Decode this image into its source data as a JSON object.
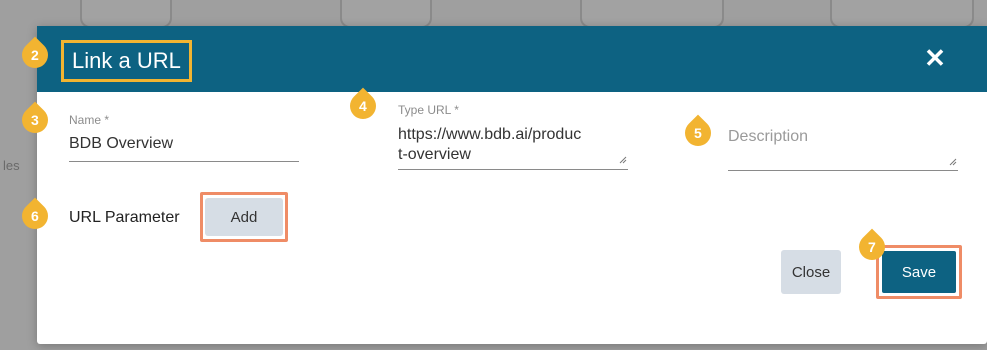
{
  "background": {
    "partial_text": "les"
  },
  "dialog": {
    "title": "Link a URL",
    "close_symbol": "✕",
    "fields": {
      "name": {
        "label": "Name *",
        "value": "BDB Overview"
      },
      "type_url": {
        "label": "Type URL *",
        "value_line1": "https://www.bdb.ai/produc",
        "value_line2": "t-overview"
      },
      "description": {
        "placeholder": "Description"
      }
    },
    "url_parameter": {
      "label": "URL Parameter",
      "add_label": "Add"
    },
    "footer": {
      "close_label": "Close",
      "save_label": "Save"
    }
  },
  "step_markers": [
    "2",
    "3",
    "4",
    "5",
    "6",
    "7"
  ],
  "colors": {
    "header": "#0d6282",
    "highlight_title": "#f2b431",
    "highlight_button": "#ef8c66",
    "marker": "#f2b431",
    "secondary_button": "#d6dde5"
  },
  "icons": {
    "close": "close-icon",
    "resize": "resize-handle-icon"
  }
}
